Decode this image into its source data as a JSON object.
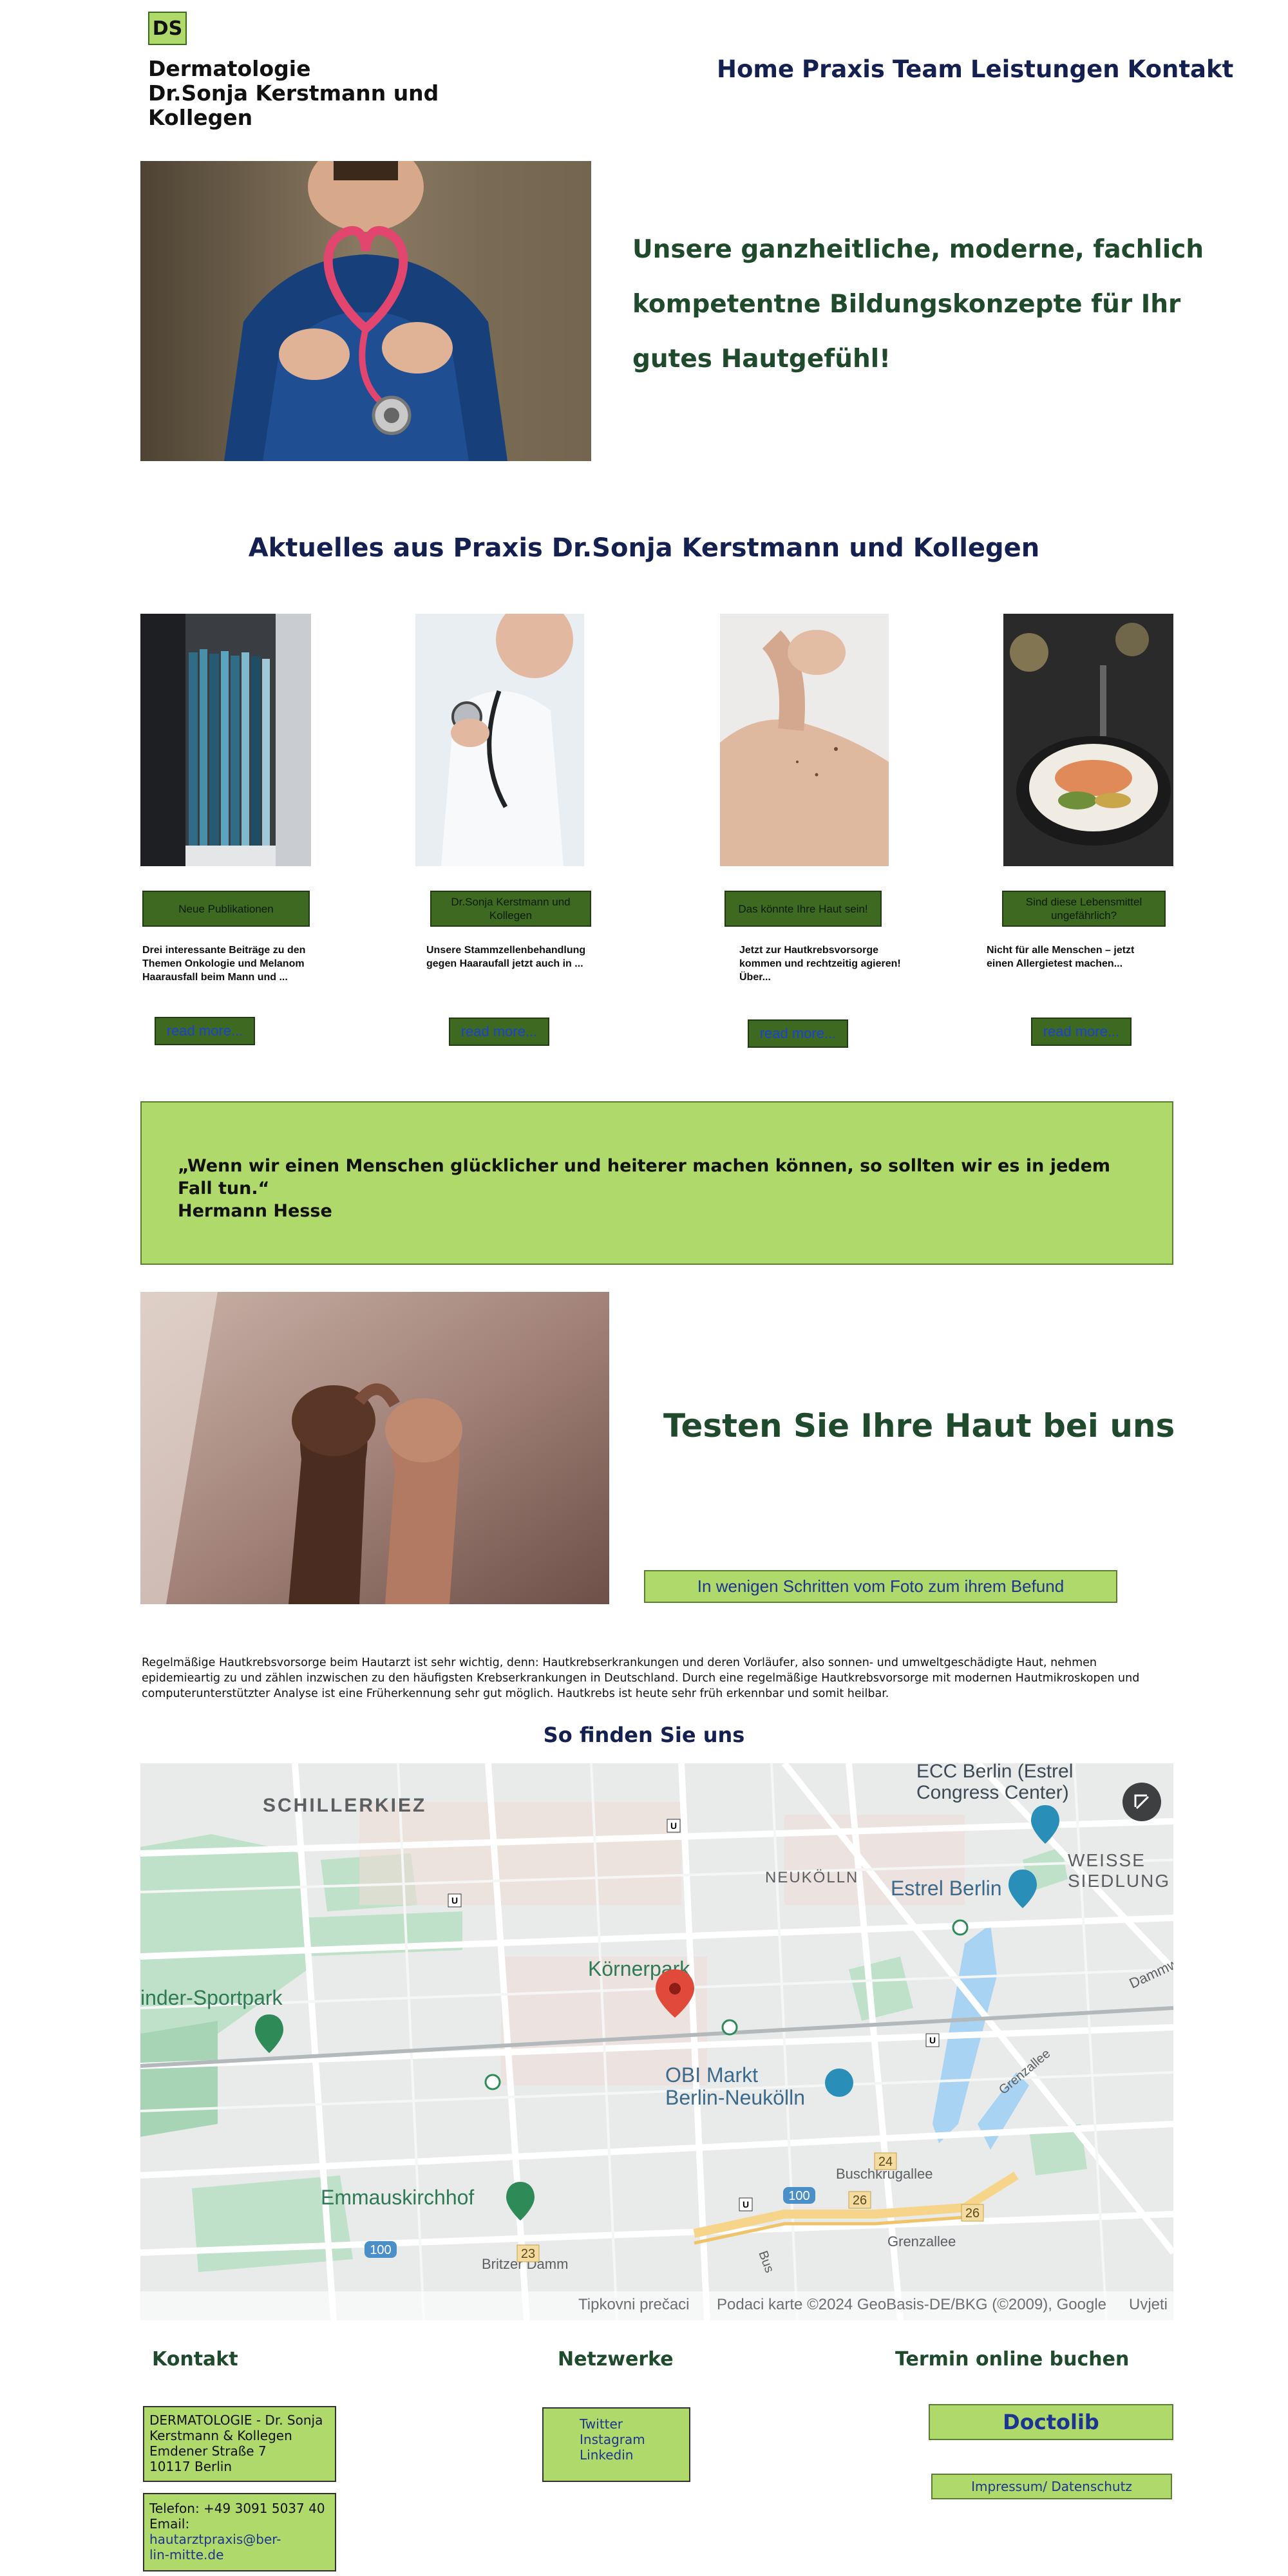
{
  "header": {
    "logo": "DS",
    "brand_line1": "Dermatologie",
    "brand_line2": "Dr.Sonja Kerstmann und",
    "brand_line3": "Kollegen",
    "nav": [
      "Home",
      "Praxis",
      "Team",
      "Leistungen",
      "Kontakt"
    ]
  },
  "hero": {
    "line1": "Unsere ganzheitliche, moderne, fachlich",
    "line2": "kompetentne Bildungskonzepte für Ihr",
    "line3": "gutes Hautgefühl!"
  },
  "news": {
    "title": "Aktuelles aus Praxis Dr.Sonja Kerstmann und Kollegen",
    "cards": [
      {
        "tag": "Neue Publikationen",
        "text": "Drei interessante Beiträge zu den Themen Onkologie und Melanom Haarausfall beim Mann und ...",
        "button": "read more..."
      },
      {
        "tag": "Dr.Sonja Kerstmann und Kollegen",
        "text": "Unsere Stammzellenbehandlung gegen Haaraufall jetzt auch in ...",
        "button": "read more..."
      },
      {
        "tag": "Das könnte Ihre Haut sein!",
        "text": "Jetzt zur Hautkrebsvorsorge kommen und rechtzeitig agieren! Über...",
        "button": "read more..."
      },
      {
        "tag": "Sind diese Lebensmittel ungefährlich?",
        "text": "Nicht für alle Menschen – jetzt einen Allergietest machen...",
        "button": "read more..."
      }
    ]
  },
  "quote": {
    "text": "„Wenn wir einen Menschen glücklicher und heiterer machen können, so sollten wir es in jedem Fall tun.“",
    "author": "Hermann Hesse"
  },
  "test": {
    "title": "Testen Sie Ihre Haut bei uns",
    "button": "In wenigen Schritten vom Foto zum ihrem Befund",
    "info": "Regelmäßige Hautkrebsvorsorge beim Hautarzt ist sehr wichtig, denn: Hautkrebserkrankungen und deren Vorläufer, also sonnen- und umweltgeschädigte Haut, nehmen epidemieartig zu und zählen inzwischen zu den häufigsten Krebserkrankungen in Deutschland. Durch eine regelmäßige Hautkrebsvorsorge mit modernen Hautmikroskopen und computerunterstützter Analyse ist eine Früherkennung sehr gut möglich. Hautkrebs ist heute sehr früh erkennbar und somit heilbar."
  },
  "map": {
    "title": "So finden Sie uns",
    "labels": {
      "schillerkiez": "SCHILLERKIEZ",
      "neukoelln": "NEUKÖLLN",
      "estrel_center_1": "ECC Berlin (Estrel",
      "estrel_center_2": "Congress Center)",
      "estrel_berlin": "Estrel Berlin",
      "weisse_1": "WEISSE",
      "weisse_2": "SIEDLUNG",
      "koernerpark": "Körnerpark",
      "sportpark": "inder-Sportpark",
      "obi_1": "OBI Markt",
      "obi_2": "Berlin-Neukölln",
      "emmaus": "Emmauskirchhof",
      "buschkrugallee": "Buschkrugallee",
      "grenzallee_road": "Grenzallee",
      "grenzallee": "Grenzallee",
      "britzer": "Britzer Damm",
      "dammweg": "Dammw",
      "bus": "Bus",
      "r23": "23",
      "r24": "24",
      "r26a": "26",
      "r26b": "26",
      "r100a": "100",
      "r100b": "100"
    },
    "footer_left": "Tipkovni prečaci",
    "footer_mid": "Podaci karte ©2024 GeoBasis-DE/BKG (©2009), Google",
    "footer_right": "Uvjeti"
  },
  "footer": {
    "kontakt_title": "Kontakt",
    "netzwerke_title": "Netzwerke",
    "termin_title": "Termin online buchen",
    "address": [
      "DERMATOLOGIE - Dr. Sonja",
      "Kerstmann & Kollegen",
      "Emdener Straße 7",
      "10117 Berlin"
    ],
    "phone": "Telefon: +49 3091 5037 40",
    "email_label": "Email:",
    "email_line1": "hautarztpraxis@ber-",
    "email_line2": "lin-mitte.de",
    "networks": [
      "Twitter",
      "Instagram",
      "Linkedin"
    ],
    "doctolib": "Doctolib",
    "impressum": "Impressum/ Datenschutz"
  },
  "colors": {
    "accent_green": "#b0d96b",
    "dark_green": "#3d6a20",
    "navy": "#14204f",
    "heading_green": "#1f4a2c"
  }
}
